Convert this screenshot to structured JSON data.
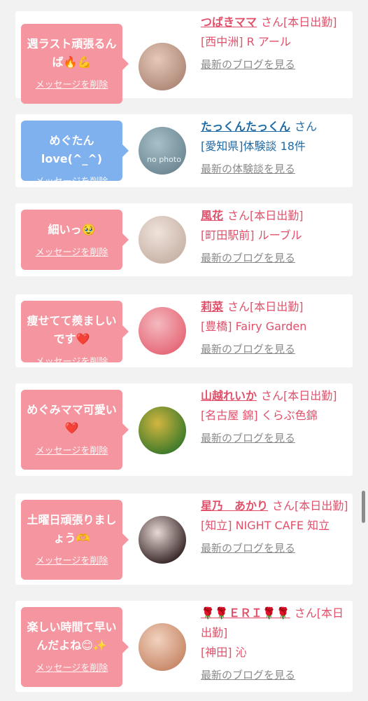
{
  "messages": [
    {
      "bubble_color": "pink",
      "message": "週ラスト頑張るんば🔥💪",
      "delete_label": "メッセージを削除",
      "name": "つばきママ",
      "san": "さん",
      "status": "[本日出勤]",
      "shop": "[西中洲] R アール",
      "blog_link": "最新のブログを見る",
      "avatar_colors": [
        "#b08a7a",
        "#e6c9b8"
      ]
    },
    {
      "bubble_color": "blue",
      "message": "めぐたんlove(^_^)",
      "delete_label": "メッセージを削除",
      "name": "たっくんたっくん",
      "san": "さん",
      "status": "",
      "shop": "[愛知県]体験談 18件",
      "blog_link": "最新の体験談を見る",
      "avatar_text": "no photo",
      "avatar_colors": [
        "#6f8a95",
        "#a7c0c9"
      ]
    },
    {
      "bubble_color": "pink",
      "message": "細いっ🥹",
      "delete_label": "メッセージを削除",
      "name": "風花",
      "san": "さん",
      "status": "[本日出勤]",
      "shop": "[町田駅前] ルーブル",
      "blog_link": "最新のブログを見る",
      "avatar_colors": [
        "#c9b4a8",
        "#efe3dc"
      ]
    },
    {
      "bubble_color": "pink",
      "message": "痩せてて羨ましいです❤️",
      "delete_label": "メッセージを削除",
      "name": "莉菜",
      "san": "さん",
      "status": "[本日出勤]",
      "shop": "[豊橋] Fairy Garden",
      "blog_link": "最新のブログを見る",
      "avatar_colors": [
        "#e66a78",
        "#f4b9c0"
      ]
    },
    {
      "bubble_color": "pink",
      "message": "めぐみママ可愛い❤️",
      "delete_label": "メッセージを削除",
      "name": "山越れいか",
      "san": "さん",
      "status": "[本日出勤]",
      "shop": "[名古屋 錦] くらぶ色錦",
      "blog_link": "最新のブログを見る",
      "avatar_colors": [
        "#3f7a2a",
        "#d2b640"
      ]
    },
    {
      "bubble_color": "pink",
      "message": "土曜日頑張りましょう🫶",
      "delete_label": "メッセージを削除",
      "name": "星乃　あかり",
      "san": "さん",
      "status": "[本日出勤]",
      "shop": "[知立] NIGHT CAFE 知立",
      "blog_link": "最新のブログを見る",
      "avatar_colors": [
        "#3a2a2a",
        "#e9d9d4"
      ]
    },
    {
      "bubble_color": "pink",
      "message": "楽しい時間て早いんだよね😊✨",
      "delete_label": "メッセージを削除",
      "name": "🌹🌹ＥＲＩ🌹🌹",
      "san": "さん",
      "status": "[本日出勤]",
      "shop": "[神田] 沁",
      "blog_link": "最新のブログを見る",
      "avatar_colors": [
        "#c88a6a",
        "#f2d2bf"
      ]
    }
  ]
}
